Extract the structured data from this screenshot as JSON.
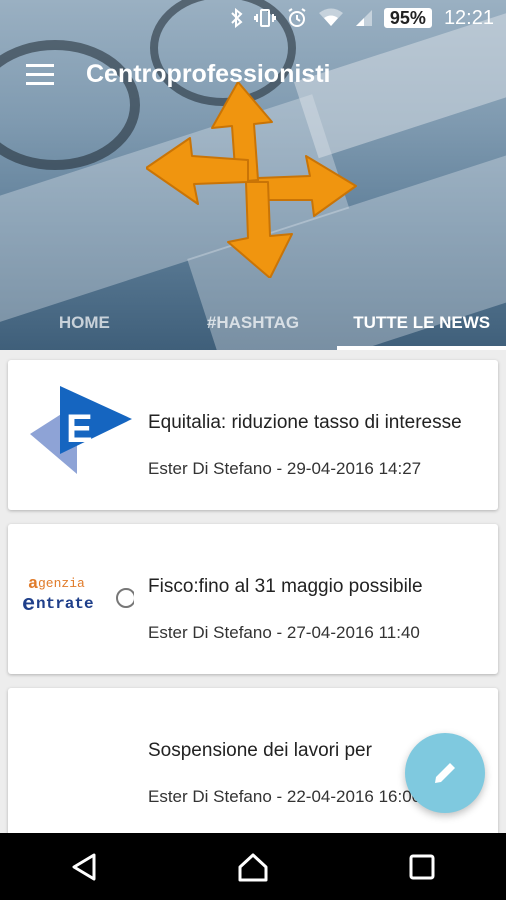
{
  "status_bar": {
    "battery": "95%",
    "time": "12:21",
    "icons": [
      "bluetooth-icon",
      "vibrate-icon",
      "alarm-icon",
      "wifi-icon",
      "signal-icon"
    ]
  },
  "app": {
    "title": "Centroprofessionisti"
  },
  "tabs": [
    {
      "label": "HOME"
    },
    {
      "label": "#HASHTAG"
    },
    {
      "label": "TUTTE LE NEWS",
      "active": true
    }
  ],
  "news": [
    {
      "title": "Equitalia: riduzione tasso di interesse",
      "meta": "Ester Di Stefano - 29-04-2016 14:27",
      "thumb": "equitalia-logo"
    },
    {
      "title": "Fisco:fino al  31 maggio  possibile",
      "meta": "Ester Di Stefano - 27-04-2016 11:40",
      "thumb": "agenzia-entrate-logo",
      "thumb_text": [
        "genzia",
        "ntrate"
      ]
    },
    {
      "title": "Sospensione dei lavori per",
      "meta": "Ester Di Stefano - 22-04-2016 16:00",
      "thumb": ""
    }
  ],
  "colors": {
    "accent_orange": "#f0950f",
    "fab": "#7fc9df",
    "equitalia_blue": "#1565c0"
  }
}
